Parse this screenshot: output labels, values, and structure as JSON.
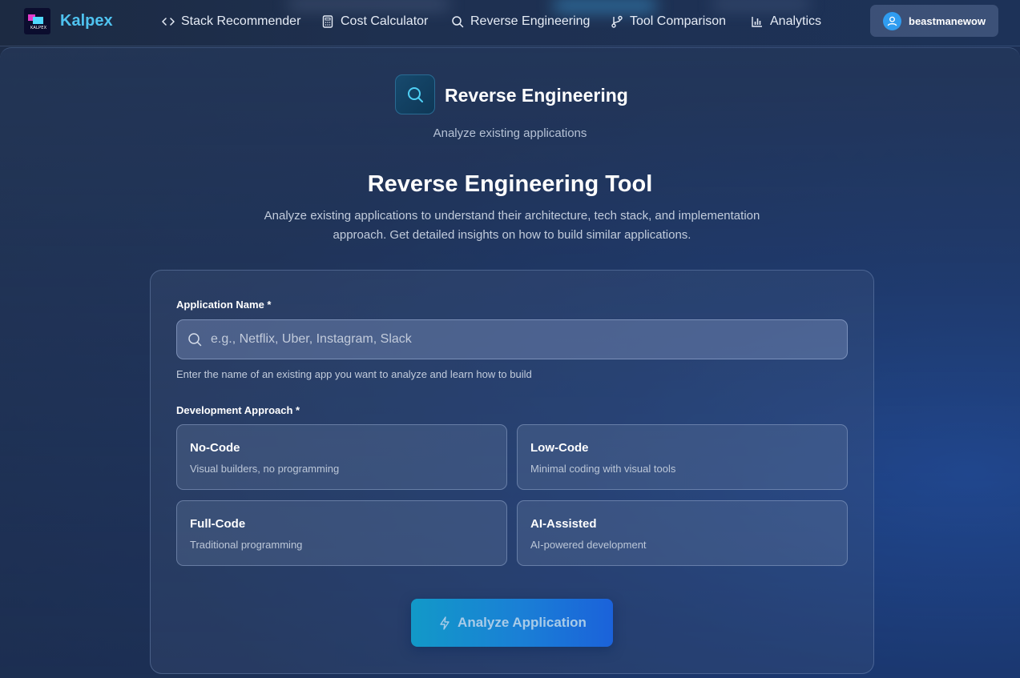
{
  "brand": {
    "logo_text": "KALPEX",
    "name": "Kalpex"
  },
  "nav": {
    "items": [
      {
        "label": "Stack Recommender",
        "icon": "code-icon"
      },
      {
        "label": "Cost Calculator",
        "icon": "calculator-icon"
      },
      {
        "label": "Reverse Engineering",
        "icon": "search-icon"
      },
      {
        "label": "Tool Comparison",
        "icon": "git-branch-icon"
      },
      {
        "label": "Analytics",
        "icon": "bar-chart-icon"
      }
    ]
  },
  "user": {
    "name": "beastmanewow"
  },
  "hero": {
    "title": "Reverse Engineering",
    "subtitle": "Analyze existing applications"
  },
  "main": {
    "title": "Reverse Engineering Tool",
    "description": "Analyze existing applications to understand their architecture, tech stack, and implementation approach. Get detailed insights on how to build similar applications."
  },
  "form": {
    "app_name_label": "Application Name *",
    "app_name_placeholder": "e.g., Netflix, Uber, Instagram, Slack",
    "app_name_value": "",
    "app_name_help": "Enter the name of an existing app you want to analyze and learn how to build",
    "approach_label": "Development Approach *",
    "approaches": [
      {
        "title": "No-Code",
        "desc": "Visual builders, no programming"
      },
      {
        "title": "Low-Code",
        "desc": "Minimal coding with visual tools"
      },
      {
        "title": "Full-Code",
        "desc": "Traditional programming"
      },
      {
        "title": "AI-Assisted",
        "desc": "AI-powered development"
      }
    ],
    "submit_label": "Analyze Application"
  },
  "colors": {
    "accent": "#4fc3f0",
    "button_start": "#1299c8",
    "button_end": "#1b62da"
  }
}
